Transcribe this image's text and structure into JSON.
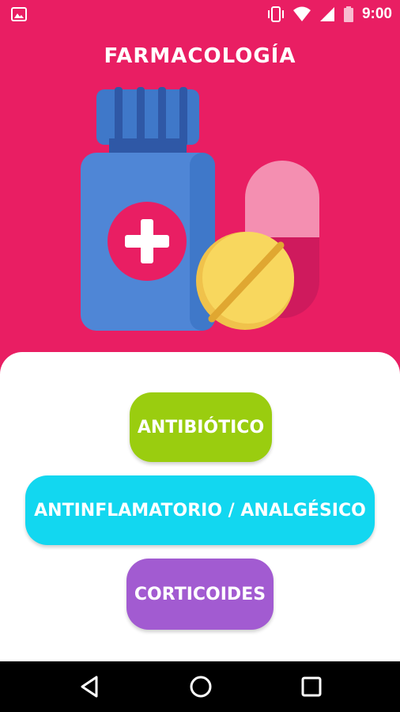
{
  "status_bar": {
    "time": "9:00",
    "icons": [
      "image-notification-icon",
      "vibrate-icon",
      "wifi-icon",
      "signal-icon",
      "battery-icon"
    ]
  },
  "app": {
    "title": "FARMACOLOGÍA",
    "hero_icons": [
      "medicine-bottle-icon",
      "cross-icon",
      "capsule-icon",
      "pill-icon"
    ]
  },
  "buttons": {
    "antibiotico": "ANTIBIÓTICO",
    "antiinflamatorio": "ANTINFLAMATORIO / ANALGÉSICO",
    "corticoides": "CORTICOIDES"
  },
  "colors": {
    "primary": "#e91e63",
    "antibiotico": "#9acd0f",
    "antiinflamatorio": "#12d7f0",
    "corticoides": "#a25bd1"
  },
  "nav_bar": {
    "icons": [
      "back-icon",
      "home-icon",
      "recent-apps-icon"
    ]
  }
}
